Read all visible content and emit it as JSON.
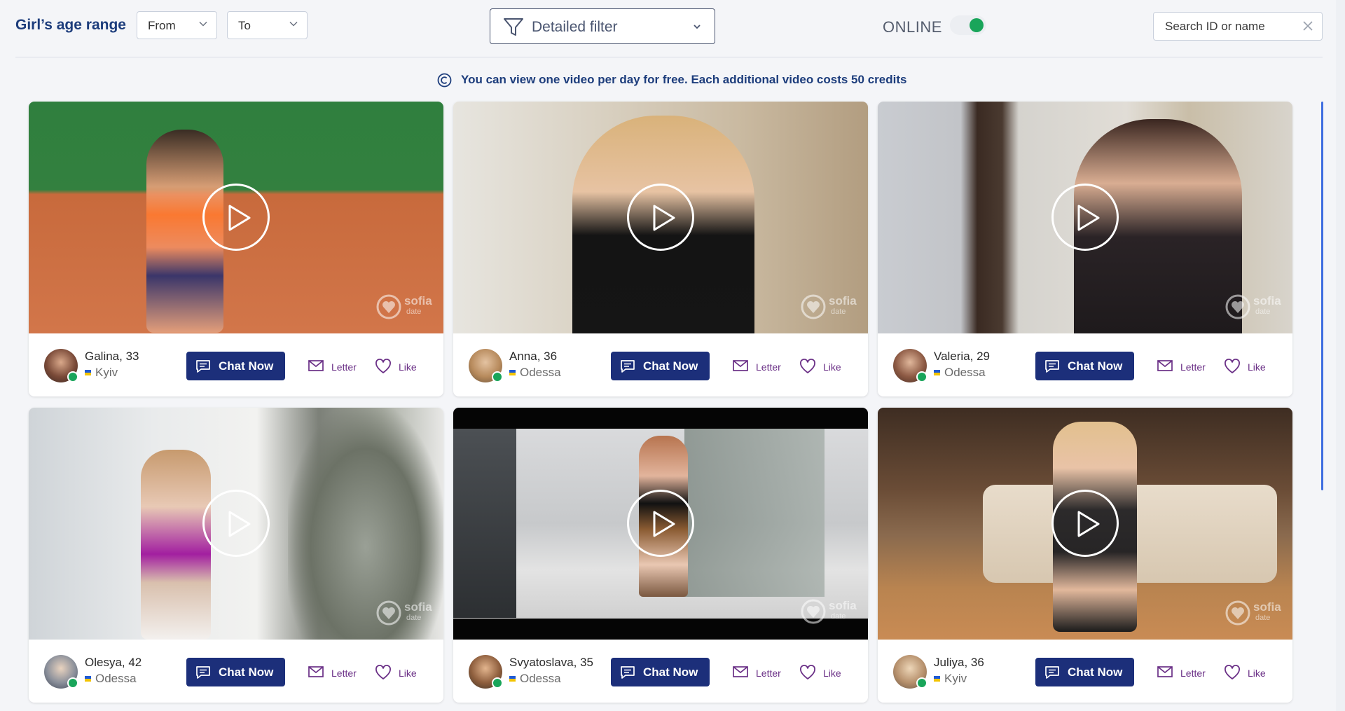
{
  "filters": {
    "age_label": "Girl’s age range",
    "from_label": "From",
    "to_label": "To",
    "detailed_label": "Detailed filter",
    "online_label": "ONLINE",
    "online_enabled": true,
    "search_placeholder": "Search ID or name"
  },
  "notice": "You can view one video per day for free. Each additional video costs 50 credits",
  "watermark": {
    "brand": "sofia",
    "sub": "date"
  },
  "actions": {
    "chat": "Chat Now",
    "letter": "Letter",
    "like": "Like"
  },
  "cards": [
    {
      "name": "Galina, 33",
      "city": "Kyiv",
      "online": true
    },
    {
      "name": "Anna, 36",
      "city": "Odessa",
      "online": true
    },
    {
      "name": "Valeria, 29",
      "city": "Odessa",
      "online": true
    },
    {
      "name": "Olesya, 42",
      "city": "Odessa",
      "online": true
    },
    {
      "name": "Svyatoslava, 35",
      "city": "Odessa",
      "online": true
    },
    {
      "name": "Juliya, 36",
      "city": "Kyiv",
      "online": true
    }
  ],
  "colors": {
    "primary": "#1c2f7a",
    "accent_text": "#6a2f86",
    "online": "#19a55a",
    "heading": "#1d3d7c"
  },
  "icons": [
    "funnel-icon",
    "chevron-down-icon",
    "close-icon",
    "credits-icon",
    "play-icon",
    "chat-icon",
    "envelope-icon",
    "heart-icon"
  ]
}
